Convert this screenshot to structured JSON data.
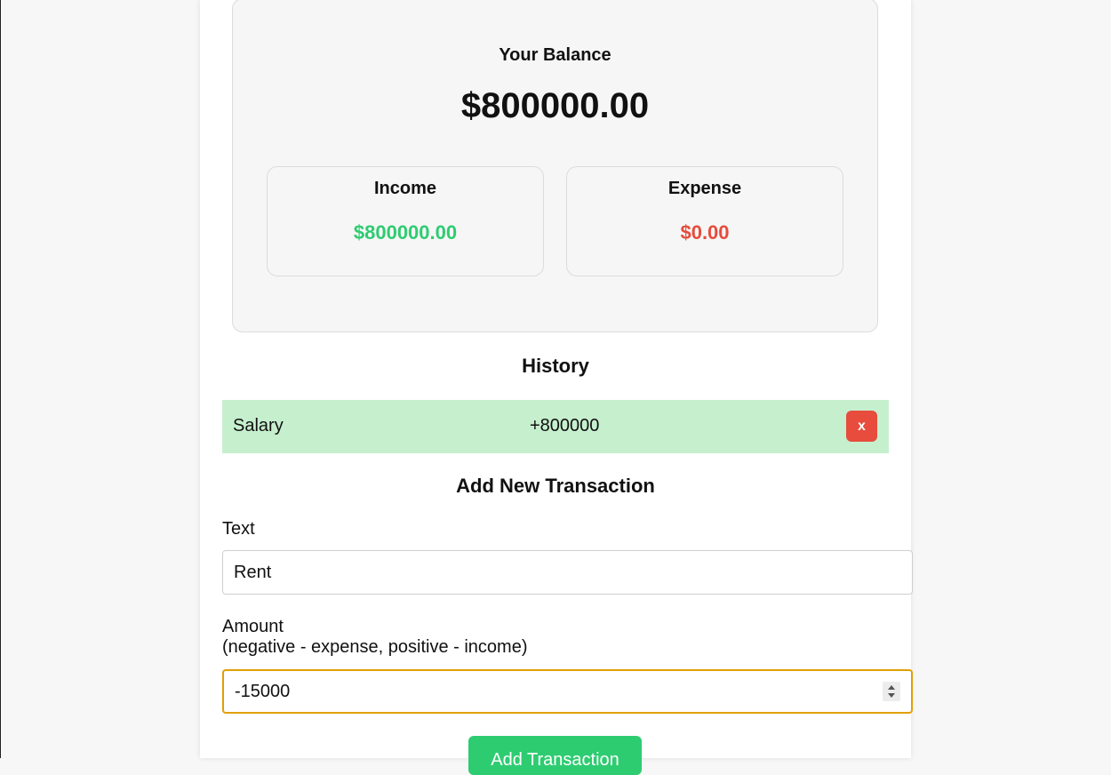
{
  "colors": {
    "income": "#2ecc71",
    "expense": "#e74c3c",
    "income_row": "#c6efce",
    "focus_outline": "#e0a000"
  },
  "balance": {
    "title": "Your Balance",
    "amount": "$800000.00"
  },
  "income": {
    "title": "Income",
    "amount": "$800000.00"
  },
  "expense": {
    "title": "Expense",
    "amount": "$0.00"
  },
  "history": {
    "title": "History",
    "items": [
      {
        "text": "Salary",
        "amount": "+800000",
        "delete_label": "x"
      }
    ]
  },
  "form": {
    "title": "Add New Transaction",
    "text_label": "Text",
    "text_value": "Rent",
    "amount_label_line1": "Amount",
    "amount_label_line2": "(negative - expense, positive - income)",
    "amount_value": "-15000",
    "submit_label": "Add Transaction"
  },
  "icons": {
    "spinner": "number-spinner-icon"
  }
}
